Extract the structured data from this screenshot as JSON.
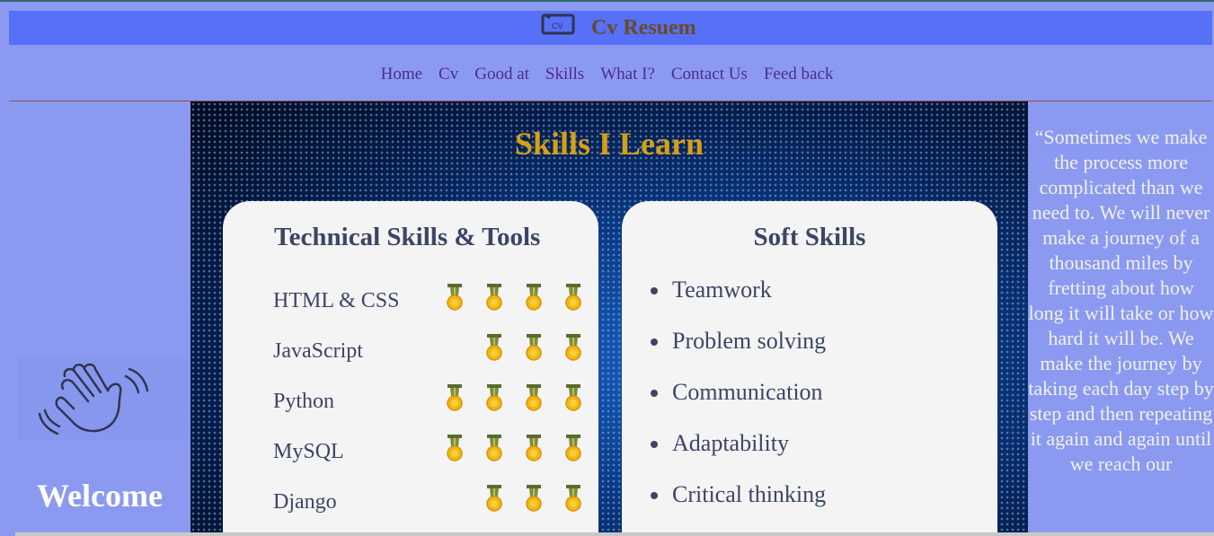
{
  "header": {
    "brand": "Cv Resuem",
    "logo_icon": "cv-monitor-icon"
  },
  "nav": {
    "items": [
      "Home",
      "Cv",
      "Good at",
      "Skills",
      "What I?",
      "Contact Us",
      "Feed back"
    ]
  },
  "left": {
    "greeting": "Welcome",
    "wave_icon": "waving-hand-icon"
  },
  "main": {
    "title": "Skills I Learn",
    "technical": {
      "heading": "Technical Skills & Tools",
      "skills": [
        {
          "name": "HTML & CSS",
          "medals": 4
        },
        {
          "name": "JavaScript",
          "medals": 3
        },
        {
          "name": "Python",
          "medals": 4
        },
        {
          "name": "MySQL",
          "medals": 4
        },
        {
          "name": "Django",
          "medals": 3
        }
      ]
    },
    "soft": {
      "heading": "Soft Skills",
      "items": [
        "Teamwork",
        "Problem solving",
        "Communication",
        "Adaptability",
        "Critical thinking"
      ]
    }
  },
  "sidebar_quote": "“Sometimes we make the process more complicated than we need to. We will never make a journey of a thousand miles by fretting about how long it will take or how hard it will be. We make the journey by taking each day step by step and then repeating it again and again until we reach our",
  "colors": {
    "header_bar": "#5670f8",
    "page_bg": "#8b9af0",
    "title_gold": "#d4a017",
    "nav_link": "#4d2b8c",
    "card_text": "#3d4466"
  }
}
